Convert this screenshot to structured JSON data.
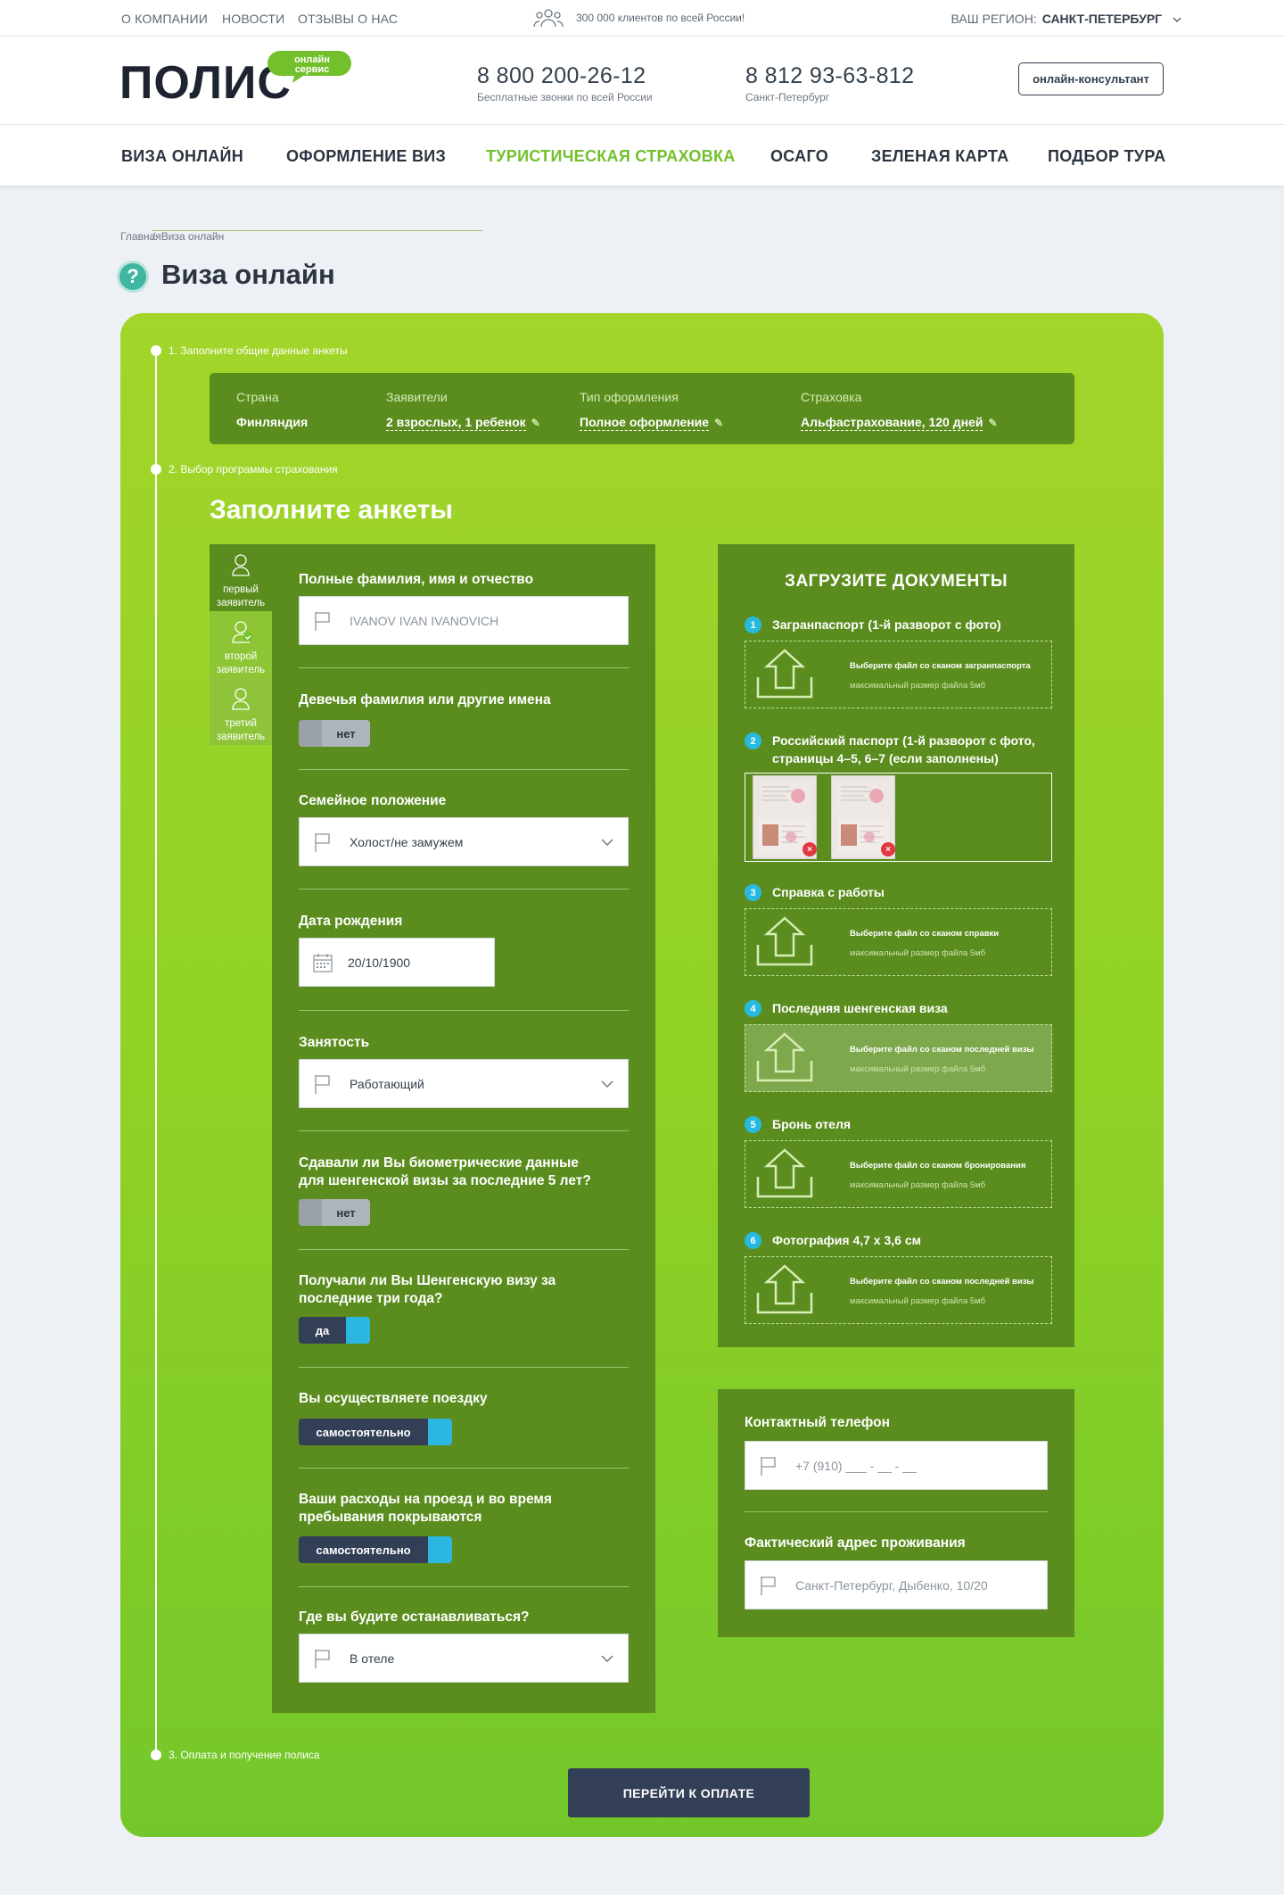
{
  "topbar": {
    "links": [
      "О компании",
      "Новости",
      "Отзывы о нас"
    ],
    "clients_text": "300 000 клиентов по всей России!",
    "region_label": "Ваш регион:",
    "region_value": "Санкт-Петербург"
  },
  "header": {
    "logo": "ПОЛИС",
    "logo_badge": "онлайн сервис",
    "phone1": "8 800 200-26-12",
    "phone1_note": "Бесплатные звонки по всей России",
    "phone2": "8 812 93-63-812",
    "phone2_note": "Санкт-Петербург",
    "consult_button": "онлайн-консультант"
  },
  "nav": {
    "items": [
      "Виза онлайн",
      "Оформление виз",
      "Туристическая страховка",
      "ОСАГО",
      "Зеленая карта",
      "Подбор тура"
    ],
    "active_index": 2
  },
  "breadcrumb": [
    "Главная",
    "Виза онлайн"
  ],
  "page_title": "Виза онлайн",
  "steps": [
    "1. Заполните общие данные анкеты",
    "2. Выбор программы страхования",
    "3. Оплата и получение полиса"
  ],
  "summary": [
    {
      "label": "Страна",
      "value": "Финляндия"
    },
    {
      "label": "Заявители",
      "value": "2 взрослых, 1 ребенок"
    },
    {
      "label": "Тип оформления",
      "value": "Полное оформление"
    },
    {
      "label": "Страховка",
      "value": "Альфастрахование, 120 дней"
    }
  ],
  "fill_title": "Заполните анкеты",
  "applicants": [
    {
      "line1": "первый",
      "line2": "заявитель"
    },
    {
      "line1": "второй",
      "line2": "заявитель"
    },
    {
      "line1": "третий",
      "line2": "заявитель"
    }
  ],
  "form": {
    "full_name_label": "Полные фамилия, имя и отчество",
    "full_name_value": "IVANOV IVAN IVANOVICH",
    "maiden_label": "Девечья фамилия или другие имена",
    "maiden_toggle": "нет",
    "marital_label": "Семейное положение",
    "marital_value": "Холост/не замужем",
    "birth_label": "Дата рождения",
    "birth_value": "20/10/1900",
    "employment_label": "Занятость",
    "employment_value": "Работающий",
    "biometric_label": "Сдавали ли Вы биометрические данные для шенгенской визы за последние 5 лет?",
    "biometric_toggle": "нет",
    "schengen_label": "Получали ли Вы Шенгенскую визу за последние три года?",
    "schengen_toggle": "да",
    "trip_label": "Вы осуществляете поездку",
    "trip_toggle": "самостоятельно",
    "expenses_label": "Ваши расходы на проезд и во время пребывания покрываются",
    "expenses_toggle": "самостоятельно",
    "stay_label": "Где вы будите останавливаться?",
    "stay_value": "В отеле"
  },
  "uploads": {
    "title": "Загрузите документы",
    "size_note": "максимальный размер файла 5мб",
    "items": [
      {
        "num": "1",
        "title": "Загранпаспорт (1-й разворот с фото)",
        "hint": "Выберите файл со сканом загранпаспорта"
      },
      {
        "num": "2",
        "title": "Российский паспорт (1-й разворот с фото, страницы 4–5, 6–7 (если заполнены)",
        "hint": ""
      },
      {
        "num": "3",
        "title": "Справка с работы",
        "hint": "Выберите файл со сканом справки"
      },
      {
        "num": "4",
        "title": "Последняя шенгенская виза",
        "hint": "Выберите файл со сканом последней визы"
      },
      {
        "num": "5",
        "title": "Бронь отеля",
        "hint": "Выберите файл со сканом бронирования"
      },
      {
        "num": "6",
        "title": "Фотография 4,7 х 3,6 см",
        "hint": "Выберите файл со сканом последней визы"
      }
    ]
  },
  "contacts": {
    "phone_label": "Контактный телефон",
    "phone_placeholder": "+7 (910) ___ - __ - __",
    "address_label": "Фактический адрес проживания",
    "address_value": "Санкт-Петербург, Дыбенко, 10/20"
  },
  "pay_button": "Перейти к оплате",
  "colors": {
    "accent_green": "#72c02c",
    "panel_green": "#5b8d1e",
    "dark_button": "#323f56",
    "toggle_cyan": "#2bb7e0",
    "step_number": "#28b9df"
  }
}
